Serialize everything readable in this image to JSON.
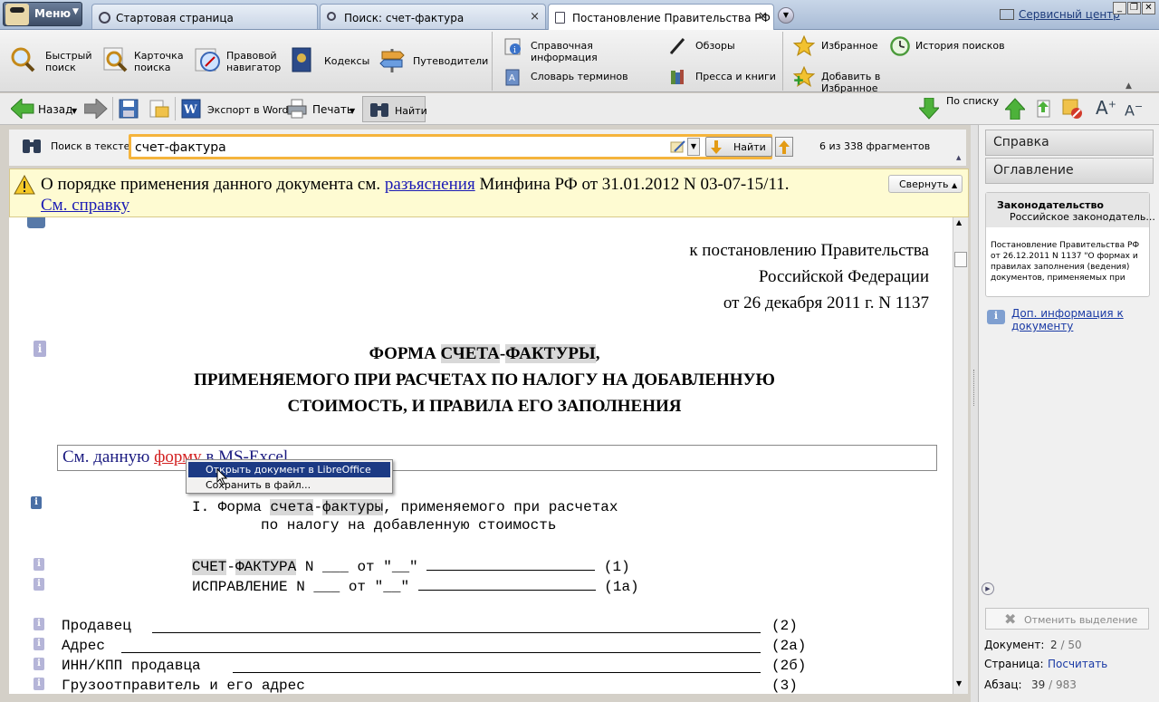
{
  "menu": {
    "label": "Меню"
  },
  "tabs": [
    {
      "label": "Стартовая страница"
    },
    {
      "label": "Поиск: счет-фактура"
    },
    {
      "label": "Постановление Правительства РФ ..."
    }
  ],
  "service_center": "Сервисный центр",
  "toolbar": {
    "quick_search": [
      "Быстрый",
      "поиск"
    ],
    "search_card": [
      "Карточка",
      "поиска"
    ],
    "legal_nav": [
      "Правовой",
      "навигатор"
    ],
    "codes": "Кодексы",
    "guides": "Путеводители",
    "reference_info": "Справочная информация",
    "reviews": "Обзоры",
    "glossary": "Словарь терминов",
    "press": "Пресса и книги",
    "favorites": "Избранное",
    "search_history": "История поисков",
    "add_favorites": "Добавить в Избранное"
  },
  "navbar": {
    "back": "Назад",
    "export_word": "Экспорт в Word",
    "print": "Печать",
    "find": "Найти",
    "by_list": "По списку"
  },
  "search": {
    "label": "Поиск в тексте",
    "value": "счет-фактура",
    "find_button": "Найти",
    "count": "6 из 338 фрагментов"
  },
  "notice": {
    "text_before": "О порядке применения данного документа см.",
    "link": "разъяснения",
    "text_after": "Минфина РФ от 31.01.2012 N 03-07-15/11.",
    "help_link": "См. справку",
    "collapse": "Свернуть"
  },
  "document": {
    "header_lines": [
      "к постановлению Правительства",
      "Российской Федерации",
      "от 26 декабря 2011 г. N 1137"
    ],
    "title_line1_before": "ФОРМА ",
    "title_hl1": "СЧЕТА",
    "title_hl2": "ФАКТУРЫ",
    "title_line2": "ПРИМЕНЯЕМОГО ПРИ РАСЧЕТАХ ПО НАЛОГУ НА ДОБАВЛЕННУЮ",
    "title_line3": "СТОИМОСТЬ, И ПРАВИЛА ЕГО ЗАПОЛНЕНИЯ",
    "excel_before": "См. данную ",
    "excel_link": "форму",
    "excel_after": " в MS-Excel.",
    "section_prefix": "I. Форма ",
    "section_hl1": "счета",
    "section_hl2": "фактуры",
    "section_rest": ", применяемого при расчетах",
    "section_line2": "по налогу на добавленную стоимость",
    "row1_hl1": "СЧЕТ",
    "row1_hl2": "ФАКТУРА",
    "row1_mid": " N ___ от \"__\" ",
    "row1_num": "(1)",
    "row2_label": "ИСПРАВЛЕНИЕ N ___ от \"__\" ",
    "row2_num": "(1а)",
    "fields": [
      {
        "label": "Продавец",
        "num": "(2)"
      },
      {
        "label": "Адрес",
        "num": "(2а)"
      },
      {
        "label": "ИНН/КПП продавца",
        "num": "(2б)"
      },
      {
        "label": "Грузоотправитель и его адрес",
        "num": "(3)"
      }
    ]
  },
  "context_menu": {
    "open_calc": "Открыть документ в LibreOffice Calc",
    "save_file": "Сохранить в файл..."
  },
  "right_panel": {
    "help_tab": "Справка",
    "toc_tab": "Оглавление",
    "card_title": "Законодательство",
    "card_sub": "Российское законодатель...",
    "card_text": "Постановление Правительства РФ от 26.12.2011 N 1137 \"О формах и правилах заполнения (ведения) документов, применяемых при",
    "more_info": "Доп. информация к документу",
    "cancel_selection": "Отменить выделение",
    "doc_label": "Документ:",
    "doc_value": "2",
    "doc_total": " / 50",
    "page_label": "Страница:",
    "page_value": "Посчитать",
    "para_label": "Абзац:",
    "para_value": "39",
    "para_total": " / 983"
  }
}
